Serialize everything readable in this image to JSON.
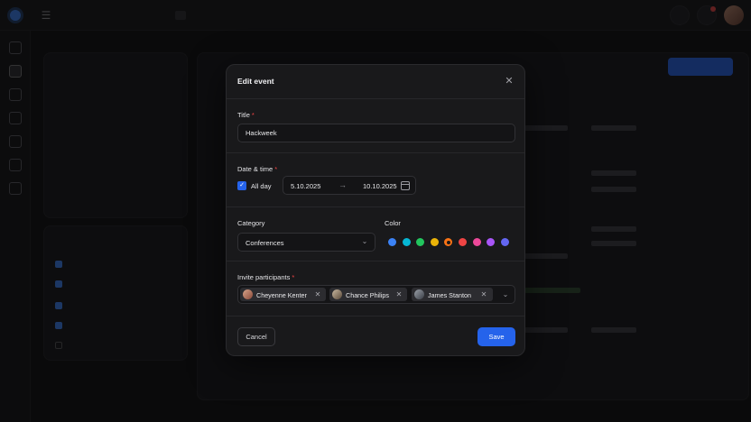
{
  "modal": {
    "title": "Edit event",
    "title_section": {
      "label": "Title",
      "required_mark": "*",
      "value": "Hackweek"
    },
    "datetime": {
      "label": "Date & time",
      "required_mark": "*",
      "all_day_label": "All day",
      "all_day_checked": true,
      "start": "5.10.2025",
      "end": "10.10.2025"
    },
    "category": {
      "label": "Category",
      "value": "Conferences"
    },
    "color": {
      "label": "Color",
      "swatches": [
        "#3b82f6",
        "#06b6d4",
        "#22c55e",
        "#eab308",
        "#f97316",
        "#ef4444",
        "#ec4899",
        "#a855f7",
        "#6366f1"
      ],
      "selected": "#f97316"
    },
    "participants": {
      "label": "Invite participants",
      "required_mark": "*",
      "people": [
        {
          "name": "Cheyenne Kenter"
        },
        {
          "name": "Chance Philips"
        },
        {
          "name": "James Stanton"
        }
      ]
    },
    "cancel_label": "Cancel",
    "save_label": "Save"
  },
  "icons": {
    "close": "close-icon",
    "arrow": "arrow-right-icon",
    "calendar": "calendar-icon",
    "chevron": "chevron-down-icon",
    "remove": "x-icon",
    "check": "check-icon"
  },
  "colors": {
    "accent": "#2563eb",
    "required": "#ef4444"
  }
}
